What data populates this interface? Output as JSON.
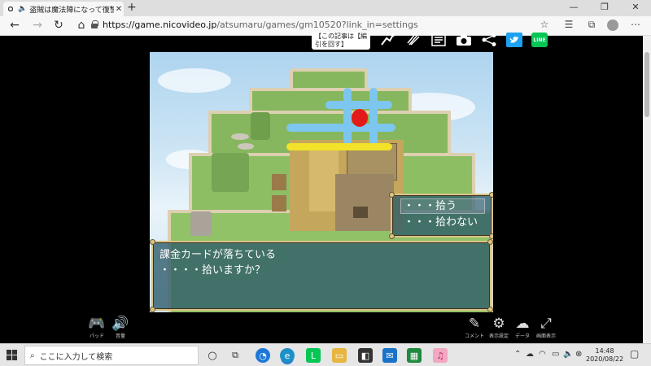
{
  "browser": {
    "tab_title": "盗賊は魔法陣になって復讐を",
    "url_host": "https://game.nicovideo.jp",
    "url_path": "/atsumaru/games/gm10520?link_in=settings",
    "new_tab": "+",
    "close_tab": "✕"
  },
  "page": {
    "tooltip_line1": "【この記事は【編",
    "tooltip_line2": "引を回す】",
    "line_label": "LINE"
  },
  "game": {
    "message_line1": "課金カードが落ちている",
    "message_line2": "・・・・拾いますか？",
    "choices": [
      "・・・拾う",
      "・・・拾わない"
    ]
  },
  "controls": {
    "pad": "パッド",
    "sound": "音量",
    "comment": "コメント",
    "display_settings": "表示設定",
    "data": "データ",
    "fullscreen": "画面表示"
  },
  "taskbar": {
    "search_placeholder": "ここに入力して検索",
    "time": "14:48",
    "date": "2020/08/22"
  },
  "colors": {
    "window_bg": "#2c5a69",
    "window_border": "#d9c487",
    "marker_blue": "#7cc6f0",
    "marker_yellow": "#f2e22a",
    "marker_red": "#e21a1a"
  }
}
